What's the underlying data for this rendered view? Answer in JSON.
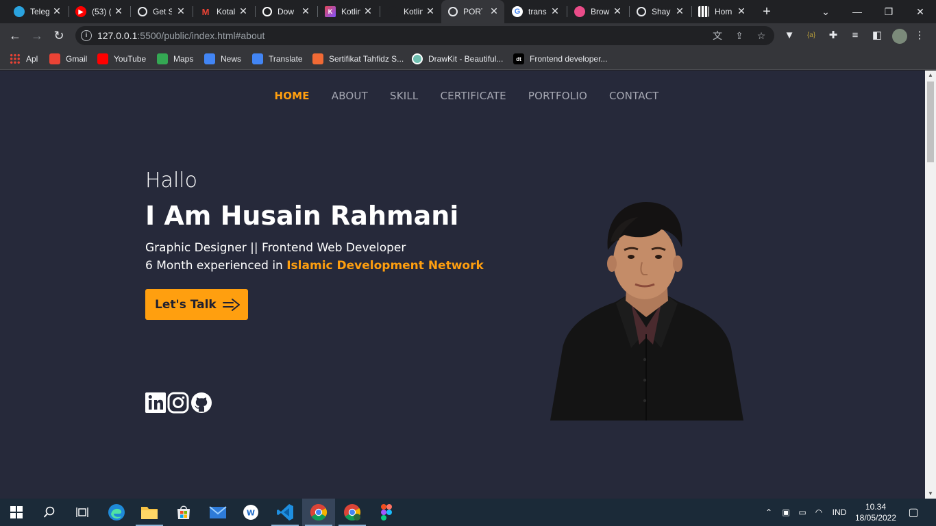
{
  "browser": {
    "tabs": [
      {
        "label": "Teleg",
        "icon": "telegram-icon",
        "color": "#2aa3df",
        "glyph": ""
      },
      {
        "label": "(53) (",
        "icon": "youtube-icon",
        "color": "#ff0000",
        "glyph": "▶"
      },
      {
        "label": "Get S",
        "icon": "globe-icon",
        "color": "#e8eaed",
        "glyph": ""
      },
      {
        "label": "Kotal",
        "icon": "gmail-icon",
        "color": "#ea4335",
        "glyph": "M"
      },
      {
        "label": "Dow",
        "icon": "download-site-icon",
        "color": "#ffffff",
        "glyph": ""
      },
      {
        "label": "Kotlin",
        "icon": "kotlin-icon",
        "color": "#7f52ff",
        "glyph": "K"
      },
      {
        "label": "Kotlin",
        "icon": "apple-icon",
        "color": "#202124",
        "glyph": ""
      },
      {
        "label": "PORT",
        "icon": "globe-icon",
        "color": "#e8eaed",
        "glyph": ""
      },
      {
        "label": "trans",
        "icon": "google-icon",
        "color": "#4285f4",
        "glyph": "G"
      },
      {
        "label": "Brow",
        "icon": "dribbble-icon",
        "color": "#ea4c89",
        "glyph": ""
      },
      {
        "label": "Shay",
        "icon": "globe-icon",
        "color": "#e8eaed",
        "glyph": ""
      },
      {
        "label": "Hom",
        "icon": "qr-icon",
        "color": "#ffffff",
        "glyph": ""
      }
    ],
    "new_tab": "+",
    "url_host": "127.0.0.1",
    "url_rest": ":5500/public/index.html#about",
    "bookmarks": [
      {
        "label": "Apl",
        "icon": "apps-grid-icon",
        "color": "#f4b400"
      },
      {
        "label": "Gmail",
        "icon": "gmail-icon",
        "color": "#ea4335"
      },
      {
        "label": "YouTube",
        "icon": "youtube-icon",
        "color": "#ff0000"
      },
      {
        "label": "Maps",
        "icon": "maps-icon",
        "color": "#34a853"
      },
      {
        "label": "News",
        "icon": "news-icon",
        "color": "#4285f4"
      },
      {
        "label": "Translate",
        "icon": "translate-icon",
        "color": "#4285f4"
      },
      {
        "label": "Sertifikat Tahfidz S...",
        "icon": "slides-icon",
        "color": "#f06a35"
      },
      {
        "label": "DrawKit - Beautiful...",
        "icon": "drawkit-icon",
        "color": "#6fbfb0"
      },
      {
        "label": "Frontend developer...",
        "icon": "dt-icon",
        "color": "#000000"
      }
    ]
  },
  "page": {
    "nav": [
      {
        "label": "HOME",
        "active": true
      },
      {
        "label": "ABOUT",
        "active": false
      },
      {
        "label": "SKILL",
        "active": false
      },
      {
        "label": "CERTIFICATE",
        "active": false
      },
      {
        "label": "PORTFOLIO",
        "active": false
      },
      {
        "label": "CONTACT",
        "active": false
      }
    ],
    "hero": {
      "greeting": "Hallo",
      "name": "I Am Husain Rahmani",
      "role": "Graphic Designer || Frontend Web Developer",
      "experience_prefix": "6 Month experienced in ",
      "experience_highlight": "Islamic Development Network",
      "cta_label": "Let's Talk"
    },
    "socials": [
      "linkedin-icon",
      "instagram-icon",
      "github-icon"
    ],
    "accent_color": "#ff9f0f",
    "background_color": "#26293a"
  },
  "taskbar": {
    "tray_language": "IND",
    "time": "10.34",
    "date": "18/05/2022"
  }
}
